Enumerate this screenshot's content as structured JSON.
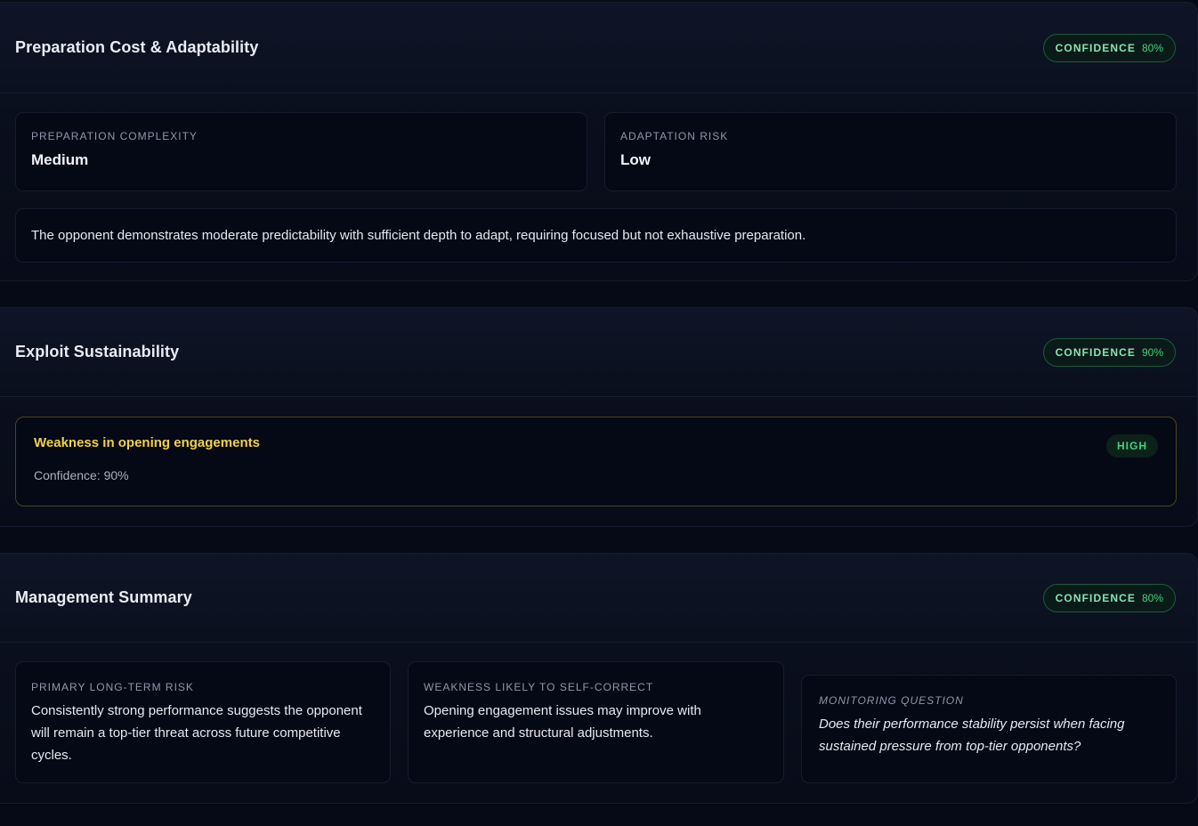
{
  "prep_panel": {
    "title": "Preparation Cost & Adaptability",
    "confidence_label": "CONFIDENCE",
    "confidence_value": "80%",
    "complexity": {
      "label": "PREPARATION COMPLEXITY",
      "value": "Medium"
    },
    "adaptation": {
      "label": "ADAPTATION RISK",
      "value": "Low"
    },
    "description": "The opponent demonstrates moderate predictability with sufficient depth to adapt, requiring focused but not exhaustive preparation."
  },
  "exploit_panel": {
    "title": "Exploit Sustainability",
    "confidence_label": "CONFIDENCE",
    "confidence_value": "90%",
    "item": {
      "title": "Weakness in opening engagements",
      "confidence": "Confidence: 90%",
      "level": "HIGH"
    }
  },
  "summary_panel": {
    "title": "Management Summary",
    "confidence_label": "CONFIDENCE",
    "confidence_value": "80%",
    "risk": {
      "label": "PRIMARY LONG-TERM RISK",
      "text": "Consistently strong performance suggests the opponent will remain a top-tier threat across future competitive cycles."
    },
    "self_correct": {
      "label": "WEAKNESS LIKELY TO SELF-CORRECT",
      "text": "Opening engagement issues may improve with experience and structural adjustments."
    },
    "monitoring": {
      "label": "MONITORING QUESTION",
      "text": "Does their performance stability persist when facing sustained pressure from top-tier opponents?"
    }
  },
  "colors": {
    "background": "#060a16",
    "accent_green": "#3fd37f",
    "warning_yellow": "#f2d24a"
  }
}
